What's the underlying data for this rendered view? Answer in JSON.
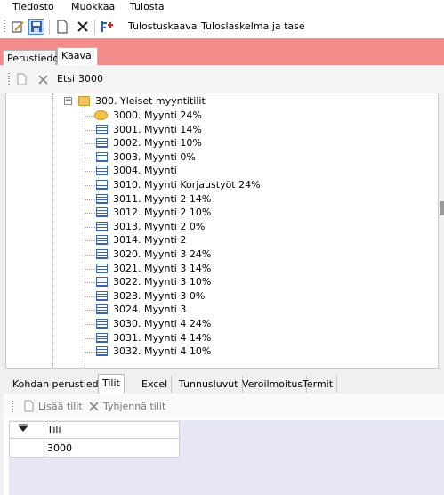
{
  "menu": [
    "Tiedosto",
    "Muokkaa",
    "Tulosta"
  ],
  "toolbar": {
    "tulostuskaava_label": "Tulostuskaava",
    "tuloslaskelma_label": "Tuloslaskelma ja tase"
  },
  "tabs": [
    "Perustiedot",
    "Kaava"
  ],
  "search": {
    "label": "Etsi",
    "value": "3000"
  },
  "tree": {
    "folder_label": "300. Yleiset myyntitilit",
    "items": [
      "3000. Myynti 24%",
      "3001. Myynti 14%",
      "3002. Myynti 10%",
      "3003. Myynti 0%",
      "3004. Myynti",
      "3010. Myynti Korjaustyöt 24%",
      "3011. Myynti 2 14%",
      "3012. Myynti 2 10%",
      "3013. Myynti 2 0%",
      "3014. Myynti 2",
      "3020. Myynti 3 24%",
      "3021. Myynti 3 14%",
      "3022. Myynti 3 10%",
      "3023. Myynti 3 0%",
      "3024. Myynti 3",
      "3030. Myynti 4 24%",
      "3031. Myynti 4 14%",
      "3032. Myynti 4 10%"
    ]
  },
  "bottom_tabs": [
    "Kohdan perustiedot",
    "Tilit",
    "Excel",
    "Tunnusluvut",
    "Veroilmoitus",
    "Termit"
  ],
  "bottom_toolbar": {
    "add_label": "Lisää tilit",
    "clear_label": "Tyhjennä tilit"
  },
  "grid": {
    "column_header": "Tili",
    "rows": [
      "3000"
    ]
  },
  "colors": {
    "banner": "#f48b8b",
    "grid_background": "#e6e6f5"
  }
}
